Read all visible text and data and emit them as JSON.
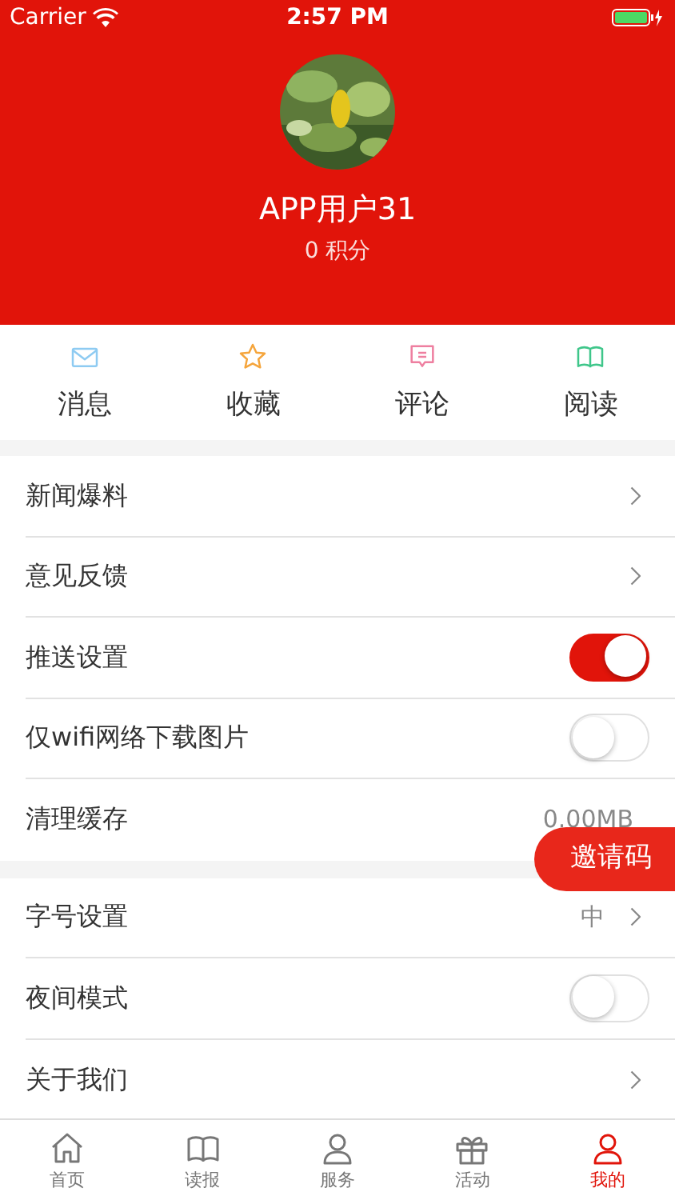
{
  "status_bar": {
    "carrier": "Carrier",
    "time": "2:57 PM"
  },
  "profile": {
    "username": "APP用户31",
    "points": "0 积分"
  },
  "shortcuts": [
    {
      "label": "消息"
    },
    {
      "label": "收藏"
    },
    {
      "label": "评论"
    },
    {
      "label": "阅读"
    }
  ],
  "sections": [
    {
      "rows": [
        {
          "label": "新闻爆料",
          "kind": "link"
        },
        {
          "label": "意见反馈",
          "kind": "link"
        },
        {
          "label": "推送设置",
          "kind": "toggle",
          "on": true
        },
        {
          "label": "仅wifi网络下载图片",
          "kind": "toggle",
          "on": false
        },
        {
          "label": "清理缓存",
          "kind": "value",
          "value": "0.00MB"
        }
      ]
    },
    {
      "rows": [
        {
          "label": "字号设置",
          "kind": "link",
          "value": "中"
        },
        {
          "label": "夜间模式",
          "kind": "toggle",
          "on": false
        },
        {
          "label": "关于我们",
          "kind": "link"
        }
      ]
    }
  ],
  "invite_button": "邀请码",
  "tab_bar": [
    {
      "label": "首页",
      "selected": false
    },
    {
      "label": "读报",
      "selected": false
    },
    {
      "label": "服务",
      "selected": false
    },
    {
      "label": "活动",
      "selected": false
    },
    {
      "label": "我的",
      "selected": true
    }
  ]
}
